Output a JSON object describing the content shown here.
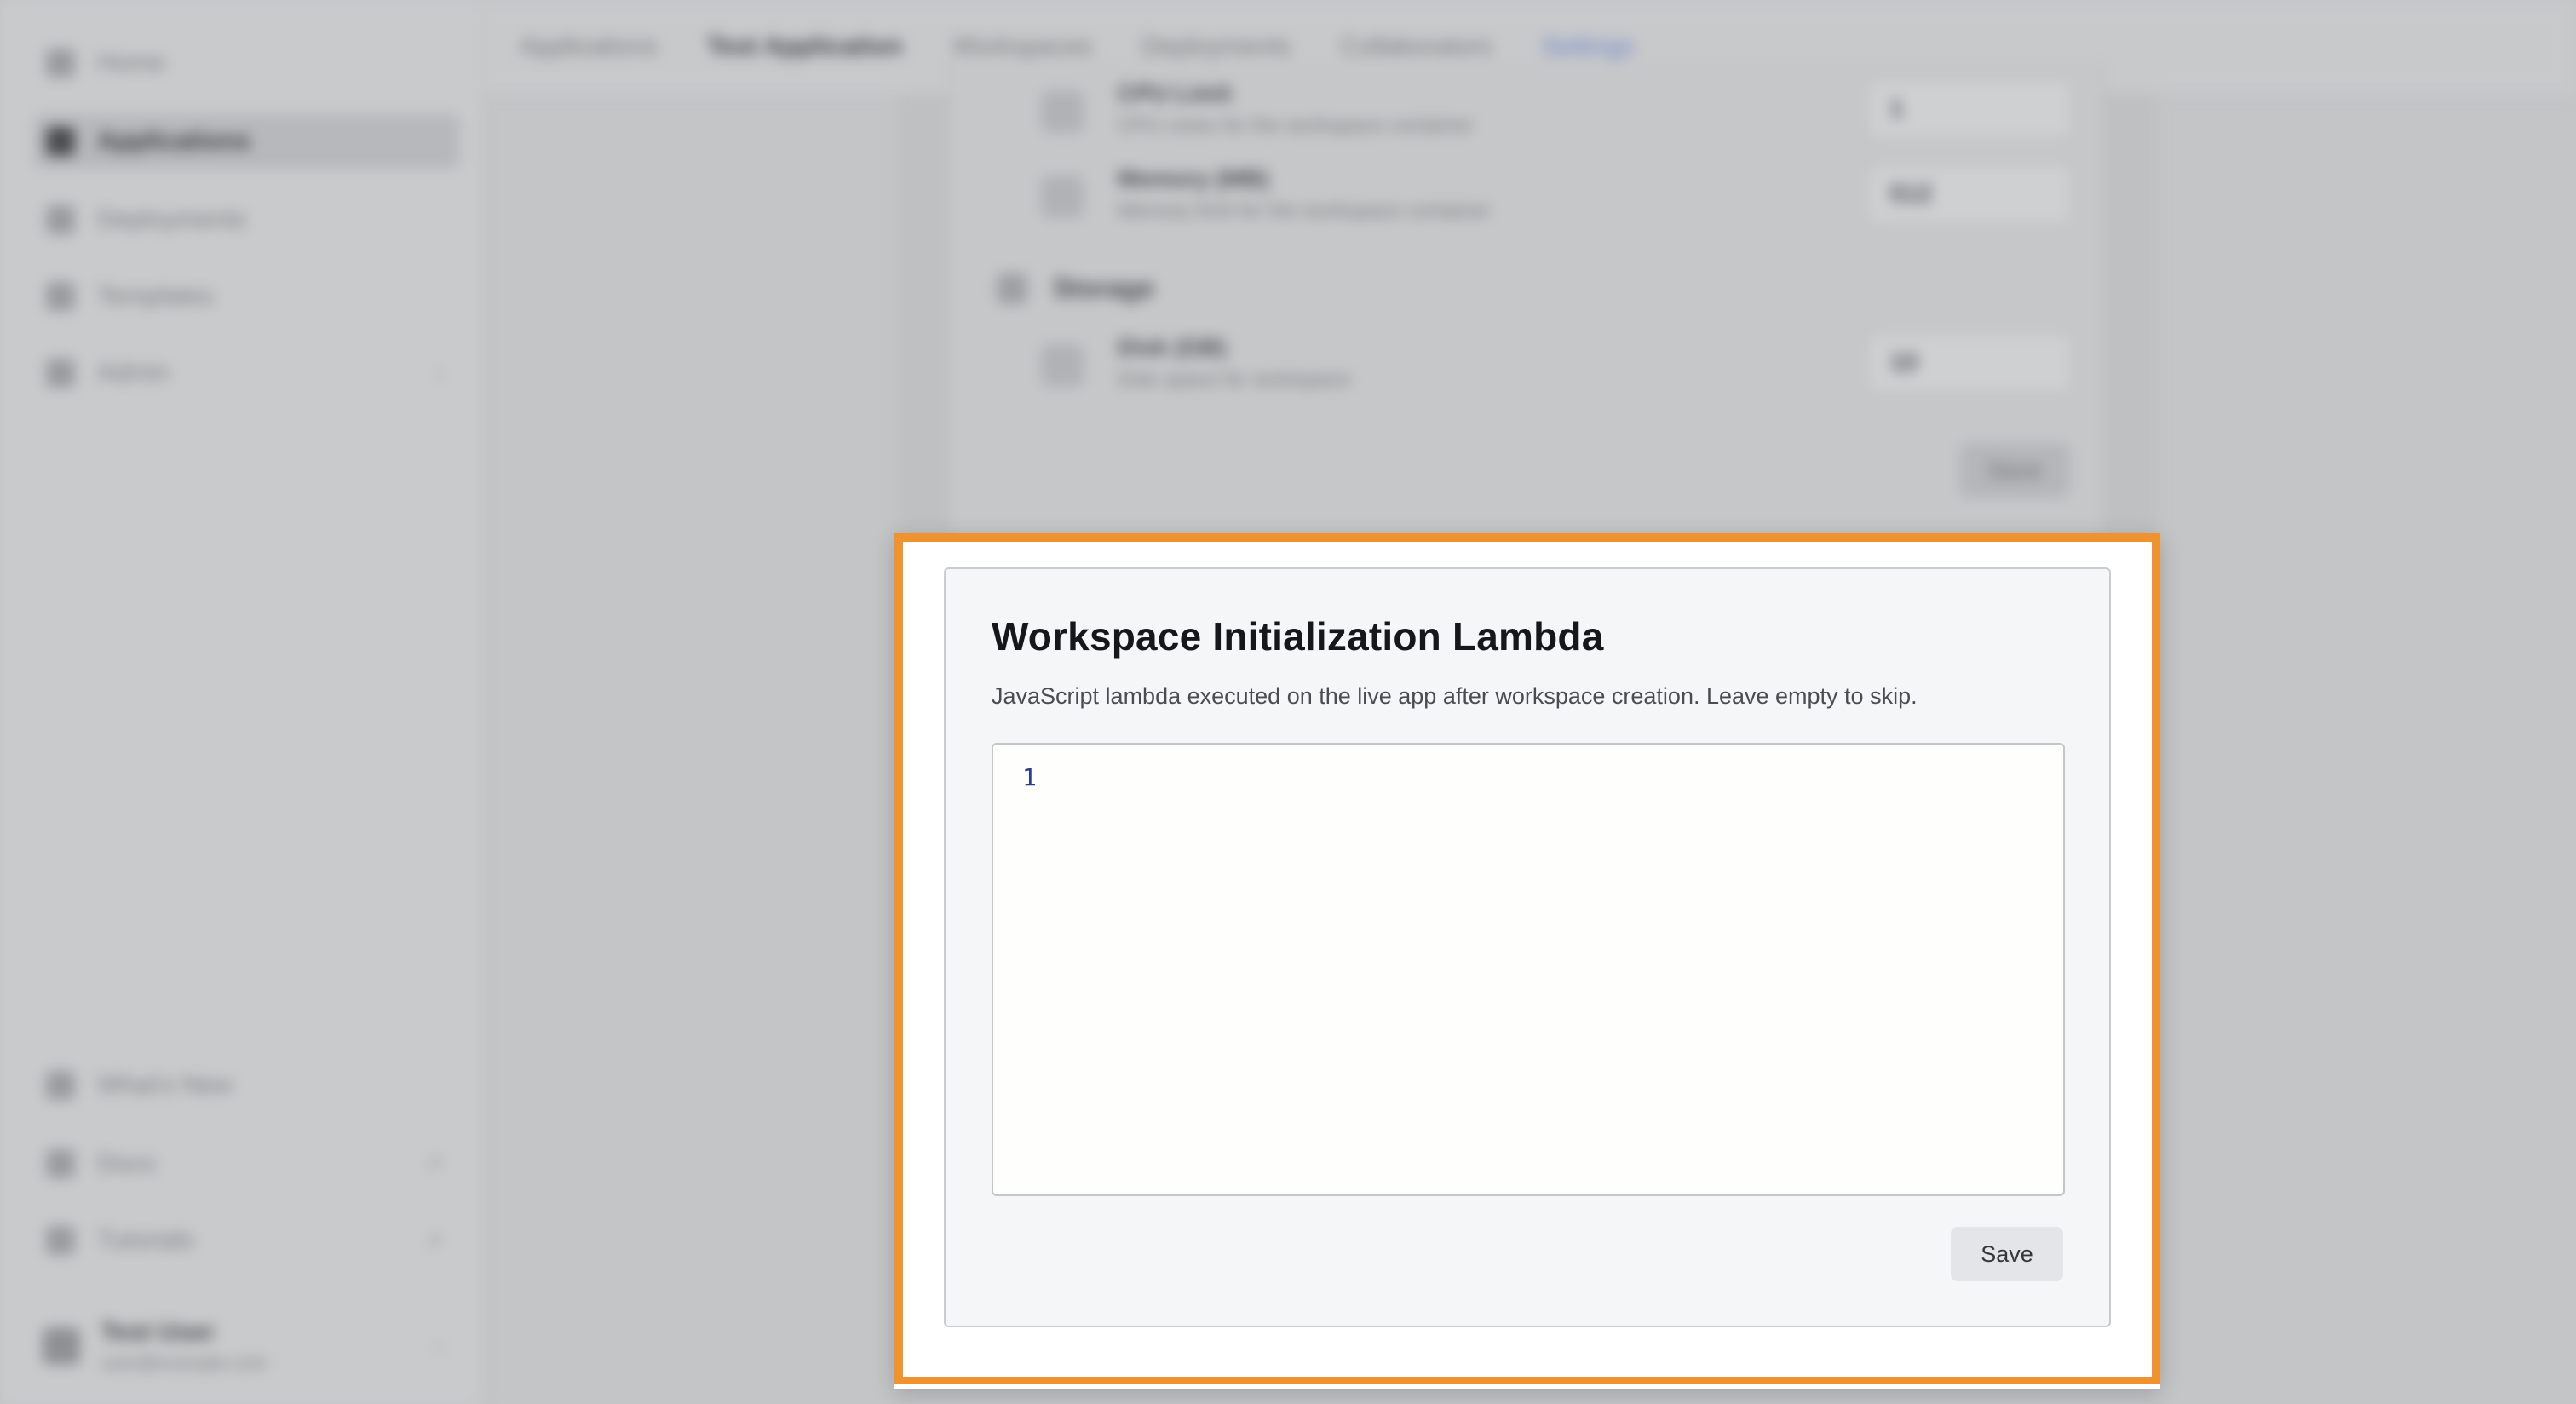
{
  "sidebar": {
    "items": [
      {
        "label": "Home",
        "icon": "home-icon"
      },
      {
        "label": "Applications",
        "icon": "grid-icon",
        "active": true
      },
      {
        "label": "Deployments",
        "icon": "rocket-icon"
      },
      {
        "label": "Templates",
        "icon": "template-icon"
      },
      {
        "label": "Admin",
        "icon": "shield-icon"
      }
    ],
    "bottom_items": [
      {
        "label": "What's New",
        "icon": "info-icon"
      },
      {
        "label": "Docs",
        "icon": "book-icon"
      },
      {
        "label": "Tutorials",
        "icon": "play-icon"
      }
    ],
    "user": {
      "name": "Test User",
      "email": "user@example.com"
    }
  },
  "topbar": {
    "tabs": [
      "Applications",
      "Test Application",
      "Workspaces",
      "Deployments",
      "Collaborators",
      "Settings"
    ],
    "active_tab": "Settings"
  },
  "background": {
    "fields": [
      {
        "title": "CPU Limit",
        "desc": "CPU cores for the workspace container",
        "value": "1"
      },
      {
        "title": "Memory (MB)",
        "desc": "Memory limit for the workspace container",
        "value": "512"
      }
    ],
    "section": "Storage",
    "storage_field": {
      "title": "Disk (GB)",
      "desc": "Disk space for workspace",
      "value": "10"
    },
    "save_label": "Save"
  },
  "modal": {
    "title": "Workspace Initialization Lambda",
    "description": "JavaScript lambda executed on the live app after workspace creation. Leave empty to skip.",
    "editor": {
      "line_number": "1",
      "content": ""
    },
    "save_label": "Save",
    "highlight_color": "#f0922e"
  }
}
